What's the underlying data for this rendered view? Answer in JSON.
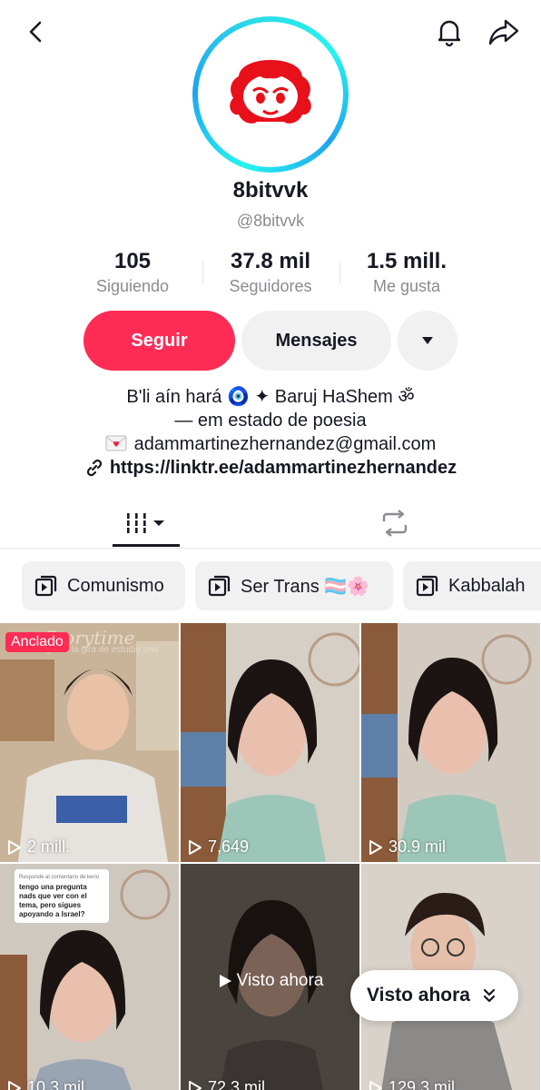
{
  "profile": {
    "username": "8bitvvk",
    "handle": "@8bitvvk"
  },
  "stats": [
    {
      "value": "105",
      "label": "Siguiendo"
    },
    {
      "value": "37.8 mil",
      "label": "Seguidores"
    },
    {
      "value": "1.5 mill.",
      "label": "Me gusta"
    }
  ],
  "actions": {
    "follow": "Seguir",
    "messages": "Mensajes"
  },
  "bio": {
    "line1": "B'li aín hará 🧿 ✦ Baruj HaShem ॐ",
    "line2": "— em estado de poesia",
    "email": "adammartinezhernandez@gmail.com",
    "link": "https://linktr.ee/adammartinezhernandez"
  },
  "playlists": [
    "Comunismo",
    "Ser Trans 🏳️‍⚧️🌸",
    "Kabbalah"
  ],
  "videos": [
    {
      "views": "2 mill.",
      "pinned_label": "Anclado",
      "overlay_title": "Storytime",
      "overlay_sub": "me negaron la gira de estudio una"
    },
    {
      "views": "7,649"
    },
    {
      "views": "30.9 mil"
    },
    {
      "views": "10.3 mil",
      "reply_small": "Responde al comentario de kerio",
      "reply_text": "tengo una pregunta nads que ver con el tema, pero sigues apoyando a Israel?"
    },
    {
      "views": "72.3 mil",
      "watched": "Visto ahora"
    },
    {
      "views": "129.3 mil"
    }
  ],
  "floating": {
    "label": "Visto ahora"
  },
  "colors": {
    "accent": "#fe2c55",
    "ring": "#25f4ee",
    "chip_bg": "#f1f1f2"
  }
}
